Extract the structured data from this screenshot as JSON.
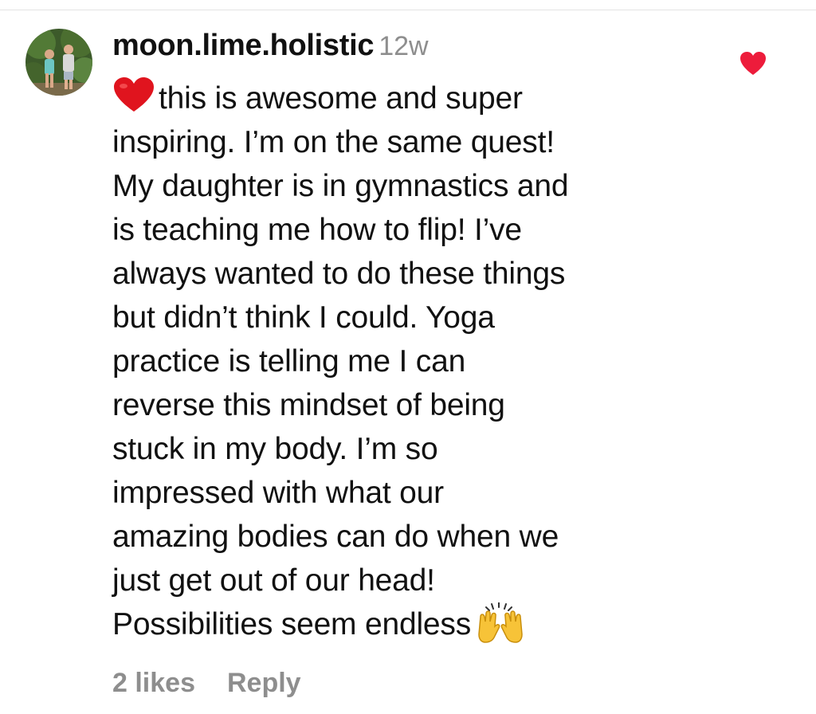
{
  "comment": {
    "username": "moon.lime.holistic",
    "timestamp": "12w",
    "avatar_icon": "user-avatar-photo",
    "heart_emoji": "❤️",
    "raised_hands_emoji": "🙌",
    "body_lines": [
      "this is awesome and super",
      "inspiring. I’m on the same quest!",
      "My daughter is in gymnastics and",
      "is teaching me how to flip! I’ve",
      "always wanted to do these things",
      "but didn’t think I could. Yoga",
      "practice is telling me I can",
      "reverse this mindset of being",
      "stuck in my body. I’m so",
      "impressed with what our",
      "amazing bodies can do when we",
      "just get out of our head!",
      "Possibilities seem endless"
    ],
    "likes_label": "2 likes",
    "reply_label": "Reply",
    "liked": true,
    "like_icon": "heart-icon"
  },
  "colors": {
    "text": "#111111",
    "muted": "#8e8e8e",
    "like_red": "#ed1c3b"
  }
}
